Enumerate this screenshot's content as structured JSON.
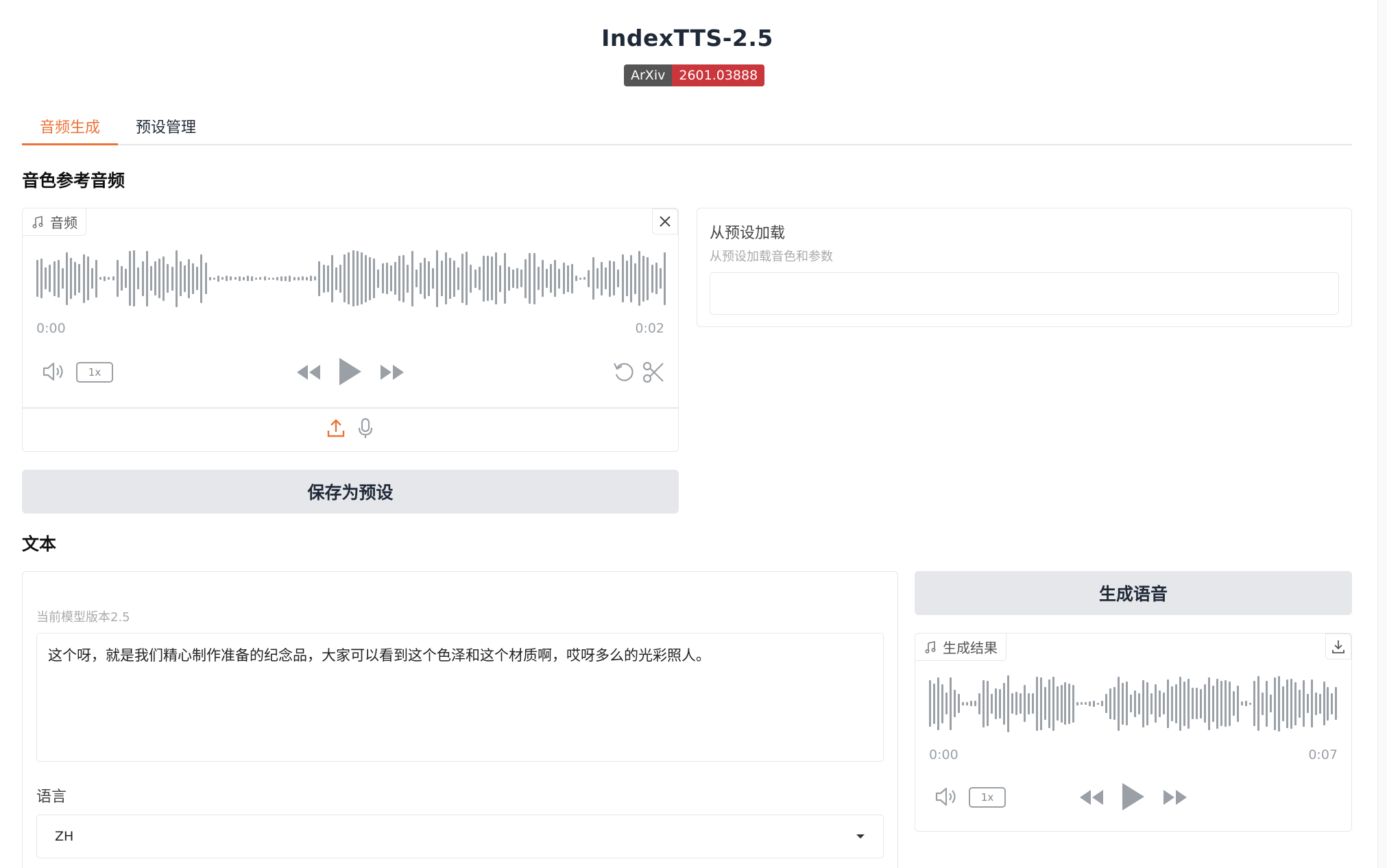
{
  "app": {
    "title": "IndexTTS-2.5",
    "badge_left": "ArXiv",
    "badge_right": "2601.03888",
    "badge_color": "#c9363c",
    "accent": "#ea7338"
  },
  "tabs": [
    {
      "label": "音频生成",
      "active": true
    },
    {
      "label": "预设管理",
      "active": false
    }
  ],
  "ref_section": {
    "heading": "音色参考音频",
    "audio_label": "音频",
    "time_start": "0:00",
    "time_end": "0:02",
    "rate": "1x"
  },
  "preset": {
    "label": "从预设加载",
    "sub": "从预设加载音色和参数",
    "value": ""
  },
  "save_button": "保存为预设",
  "text_section": {
    "heading": "文本",
    "model_version": "当前模型版本2.5",
    "content": "这个呀，就是我们精心制作准备的纪念品，大家可以看到这个色泽和这个材质啊，哎呀多么的光彩照人。",
    "language_label": "语言",
    "language_value": "ZH"
  },
  "generate_button": "生成语音",
  "result": {
    "label": "生成结果",
    "time_start": "0:00",
    "time_end": "0:07",
    "rate": "1x"
  }
}
